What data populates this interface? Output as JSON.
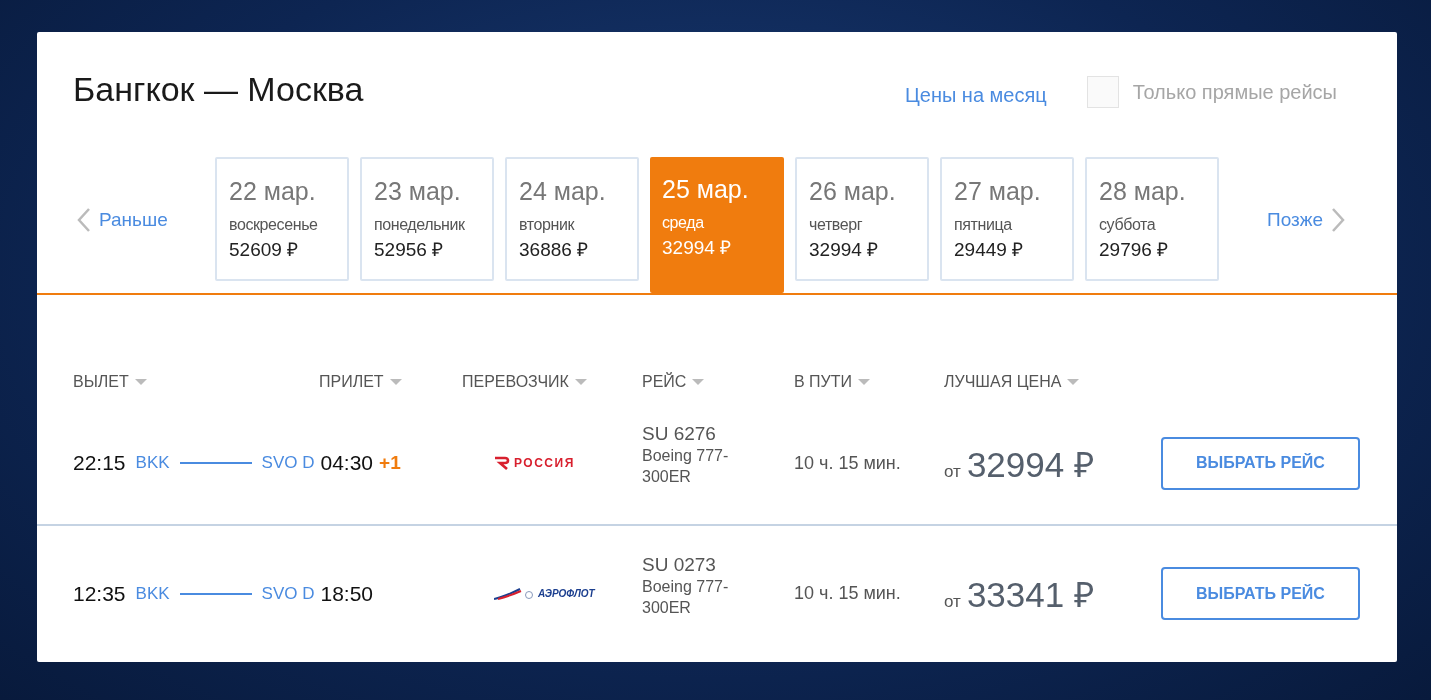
{
  "title": "Бангкок — Москва",
  "month_link": "Цены на месяц",
  "direct_only": {
    "label": "Только прямые рейсы",
    "checked": false
  },
  "prev": "Раньше",
  "next": "Позже",
  "dates": [
    {
      "date": "22 мар.",
      "weekday": "воскресенье",
      "price": "52609 ₽",
      "selected": false
    },
    {
      "date": "23 мар.",
      "weekday": "понедельник",
      "price": "52956 ₽",
      "selected": false
    },
    {
      "date": "24 мар.",
      "weekday": "вторник",
      "price": "36886 ₽",
      "selected": false
    },
    {
      "date": "25 мар.",
      "weekday": "среда",
      "price": "32994 ₽",
      "selected": true
    },
    {
      "date": "26 мар.",
      "weekday": "четверг",
      "price": "32994 ₽",
      "selected": false
    },
    {
      "date": "27 мар.",
      "weekday": "пятница",
      "price": "29449 ₽",
      "selected": false
    },
    {
      "date": "28 мар.",
      "weekday": "суббота",
      "price": "29796 ₽",
      "selected": false
    }
  ],
  "columns": [
    "ВЫЛЕТ",
    "ПРИЛЕТ",
    "ПЕРЕВОЗЧИК",
    "РЕЙС",
    "В ПУТИ",
    "ЛУЧШАЯ ЦЕНА"
  ],
  "flights": [
    {
      "dep_time": "22:15",
      "dep_airport": "BKK",
      "arr_airport": "SVO D",
      "arr_time": "04:30",
      "next_day": "+1",
      "airline": {
        "kind": "rossiya",
        "text": "РОССИЯ"
      },
      "flight": "SU 6276",
      "aircraft": "Boeing 777-300ER",
      "duration": "10 ч. 15 мин.",
      "price_prefix": "от",
      "price": "32994 ₽",
      "button": "ВЫБРАТЬ РЕЙС"
    },
    {
      "dep_time": "12:35",
      "dep_airport": "BKK",
      "arr_airport": "SVO D",
      "arr_time": "18:50",
      "airline": {
        "kind": "aeroflot",
        "text": "АЭРОФЛОТ"
      },
      "flight": "SU 0273",
      "aircraft": "Boeing 777-300ER",
      "duration": "10 ч. 15 мин.",
      "price_prefix": "от",
      "price": "33341 ₽",
      "button": "ВЫБРАТЬ РЕЙС"
    }
  ]
}
